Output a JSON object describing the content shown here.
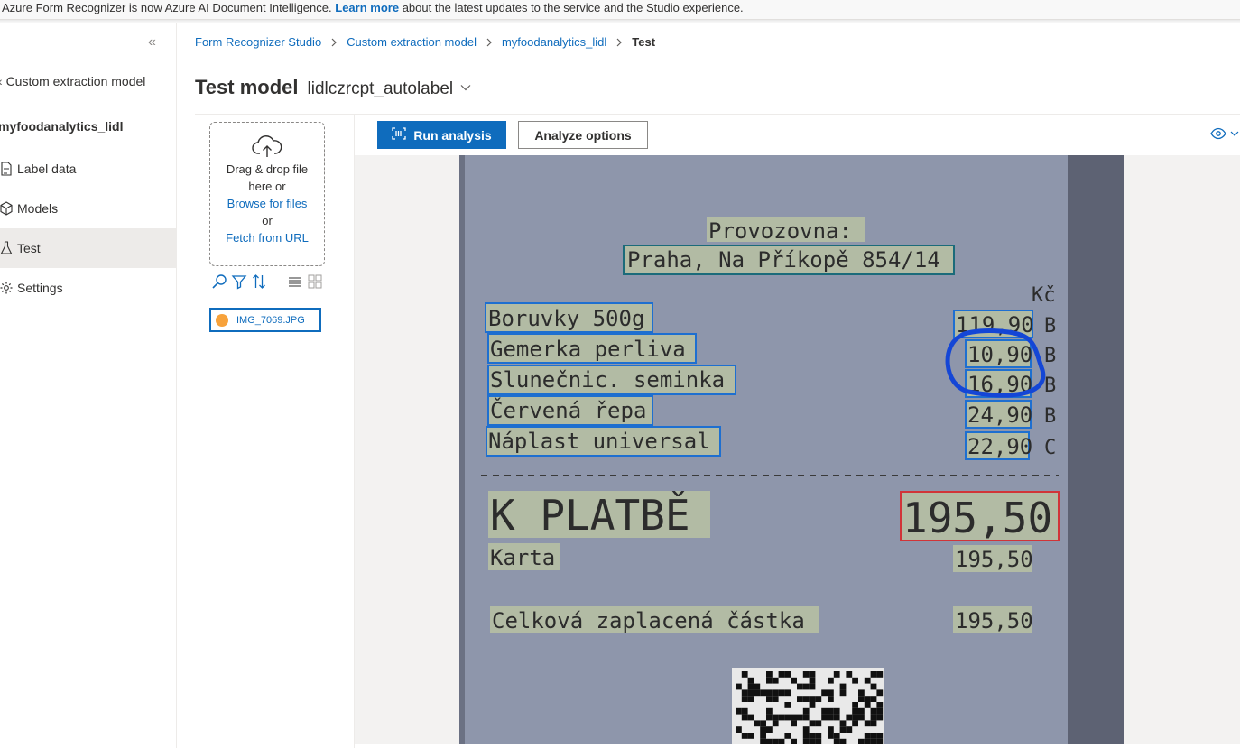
{
  "banner": {
    "prefix": "Azure Form Recognizer is now Azure AI Document Intelligence.",
    "link": "Learn more",
    "suffix": "about the latest updates to the service and the Studio experience."
  },
  "nav": {
    "collapse_icon": "double-chevron-left-icon",
    "back_label": "Custom extraction model",
    "project_label": "myfoodanalytics_lidl",
    "items": [
      {
        "label": "Label data",
        "icon": "document-icon",
        "active": false
      },
      {
        "label": "Models",
        "icon": "cube-icon",
        "active": false
      },
      {
        "label": "Test",
        "icon": "flask-icon",
        "active": true
      },
      {
        "label": "Settings",
        "icon": "gear-icon",
        "active": false
      }
    ]
  },
  "breadcrumb": [
    "Form Recognizer Studio",
    "Custom extraction model",
    "myfoodanalytics_lidl",
    "Test"
  ],
  "header": {
    "title": "Test model",
    "model_name": "lidlczrcpt_autolabel"
  },
  "upload": {
    "line1": "Drag & drop file",
    "line2": "here or",
    "browse": "Browse for files",
    "or": "or",
    "fetch": "Fetch from URL"
  },
  "file": {
    "name": "IMG_7069.JPG",
    "status_color": "#f7a23b"
  },
  "toolbar": {
    "run_label": "Run analysis",
    "options_label": "Analyze options"
  },
  "receipt": {
    "header_line1": "Provozovna:",
    "header_line2": "Praha, Na Příkopě 854/14",
    "currency_col": "Kč",
    "items": [
      {
        "name": "Boruvky 500g",
        "price": "119,90",
        "tax": "B"
      },
      {
        "name": "Gemerka perliva",
        "price": "10,90",
        "tax": "B"
      },
      {
        "name": "Slunečnic. seminka",
        "price": "16,90",
        "tax": "B"
      },
      {
        "name": "Červená řepa",
        "price": "24,90",
        "tax": "B"
      },
      {
        "name": "Náplast universal",
        "price": "22,90",
        "tax": "C"
      }
    ],
    "total_label": "K PLATBĚ",
    "total_value": "195,50",
    "card_label": "Karta",
    "card_value": "195,50",
    "paid_label": "Celková zaplacená částka",
    "paid_value": "195,50"
  },
  "colors": {
    "accent": "#0f6cbd",
    "field_box": "#1e6fd0",
    "total_box": "#d13438",
    "address_box": "#1b6b7a"
  }
}
